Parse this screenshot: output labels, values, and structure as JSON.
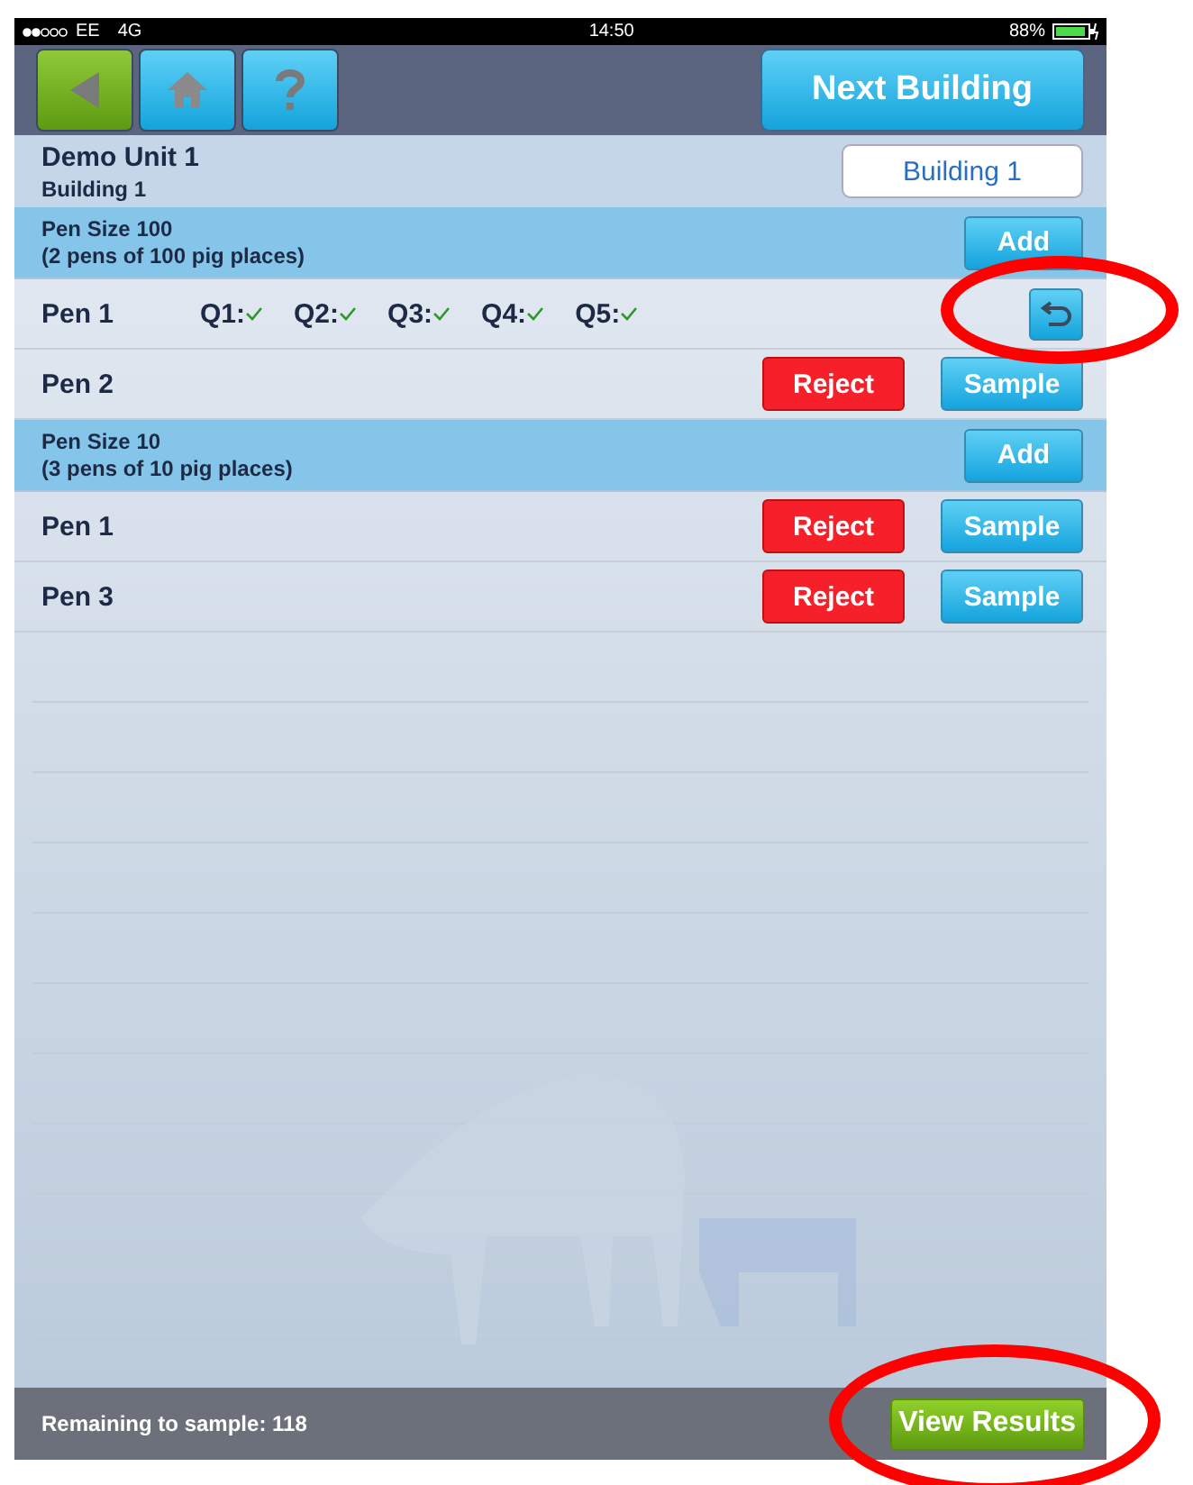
{
  "status_bar": {
    "carrier": "EE",
    "network": "4G",
    "time": "14:50",
    "battery": "88%"
  },
  "toolbar": {
    "buttons": [
      {
        "kind": "back",
        "selected": true
      },
      {
        "kind": "home",
        "selected": false
      },
      {
        "kind": "help",
        "selected": false
      }
    ],
    "next_button": "Next Building"
  },
  "header": {
    "unit": "Demo Unit 1",
    "building": "Building 1",
    "building_button": "Building 1"
  },
  "groups": [
    {
      "title": "Pen Size 100",
      "subtitle": "(2 pens of 100 pig places)",
      "add": "Add",
      "pens": [
        {
          "name": "Pen 1",
          "kind": "answered",
          "answers": [
            {
              "label": "Q1:",
              "checked": true
            },
            {
              "label": "Q2:",
              "checked": true
            },
            {
              "label": "Q3:",
              "checked": true
            },
            {
              "label": "Q4:",
              "checked": true
            },
            {
              "label": "Q5:",
              "checked": true
            }
          ]
        },
        {
          "name": "Pen 2",
          "kind": "pending",
          "reject": "Reject",
          "sample": "Sample"
        }
      ]
    },
    {
      "title": "Pen Size 10",
      "subtitle": "(3 pens of 10 pig places)",
      "add": "Add",
      "pens": [
        {
          "name": "Pen 1",
          "kind": "pending",
          "reject": "Reject",
          "sample": "Sample"
        },
        {
          "name": "Pen 3",
          "kind": "pending",
          "reject": "Reject",
          "sample": "Sample"
        }
      ]
    }
  ],
  "footer": {
    "remaining": "Remaining to sample: 118",
    "results_button": "View Results"
  },
  "annotations": [
    {
      "kind": "ellipse"
    },
    {
      "kind": "ellipse"
    }
  ]
}
